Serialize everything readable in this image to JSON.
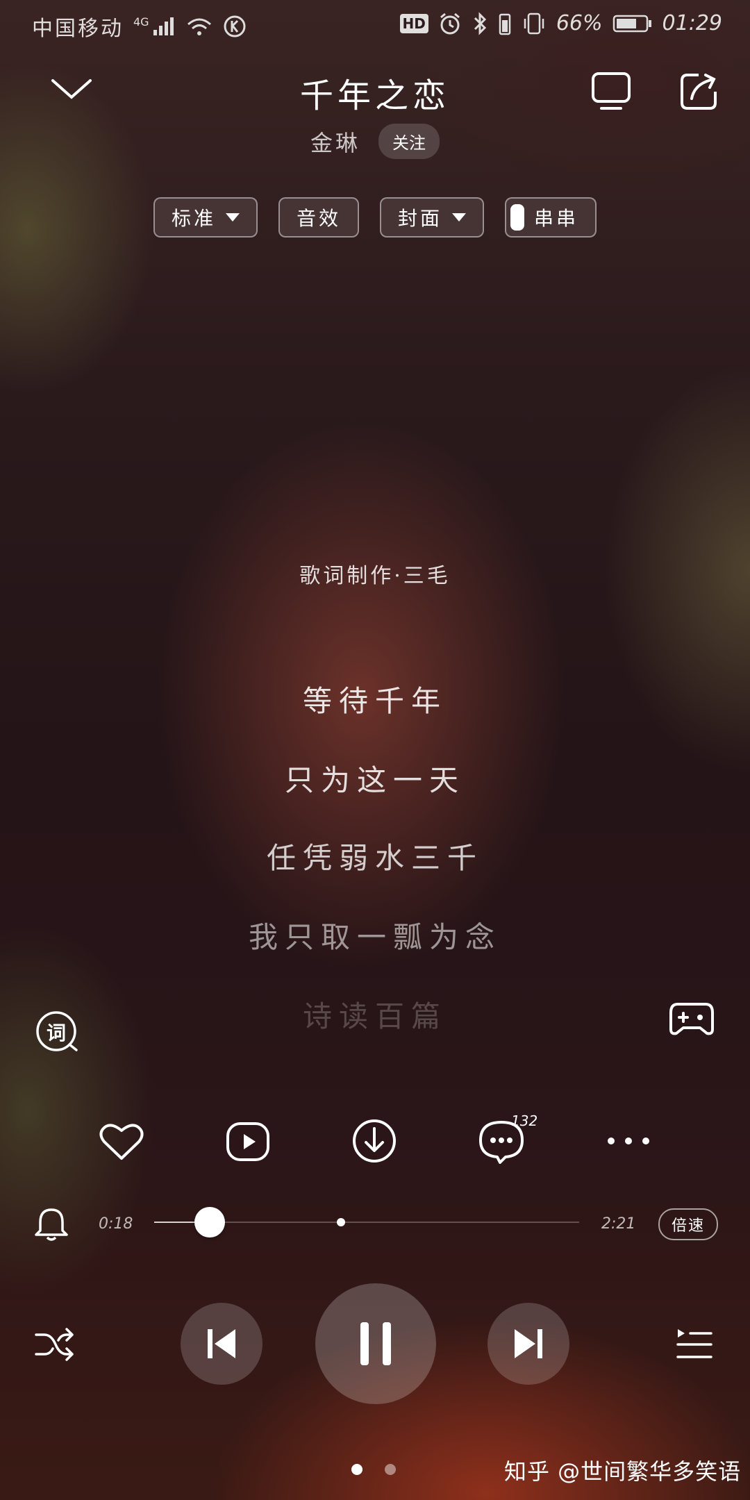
{
  "status_bar": {
    "carrier": "中国移动",
    "network": "4G",
    "battery_percent": "66%",
    "time": "01:29",
    "hd_label": "HD"
  },
  "header": {
    "title": "千年之恋",
    "artist": "金琳",
    "follow_label": "关注"
  },
  "toolbar": {
    "quality_label": "标准",
    "effects_label": "音效",
    "cover_label": "封面",
    "chuanchuan_label": "串串"
  },
  "lyrics": {
    "credit": "歌词制作·三毛",
    "lines": [
      "等待千年",
      "只为这一天",
      "任凭弱水三千",
      "我只取一瓢为念",
      "诗读百篇"
    ]
  },
  "lyric_mode_label": "词",
  "actions": {
    "comment_count": "132"
  },
  "playback": {
    "elapsed": "0:18",
    "duration": "2:21",
    "progress": 0.13,
    "buffered": 0.44,
    "speed_label": "倍速"
  },
  "pager": {
    "pages": 2,
    "active": 0
  },
  "watermark": "知乎 @世间繁华多笑语",
  "colors": {
    "accent": "#ffffff",
    "background": "#2b1a1c"
  }
}
